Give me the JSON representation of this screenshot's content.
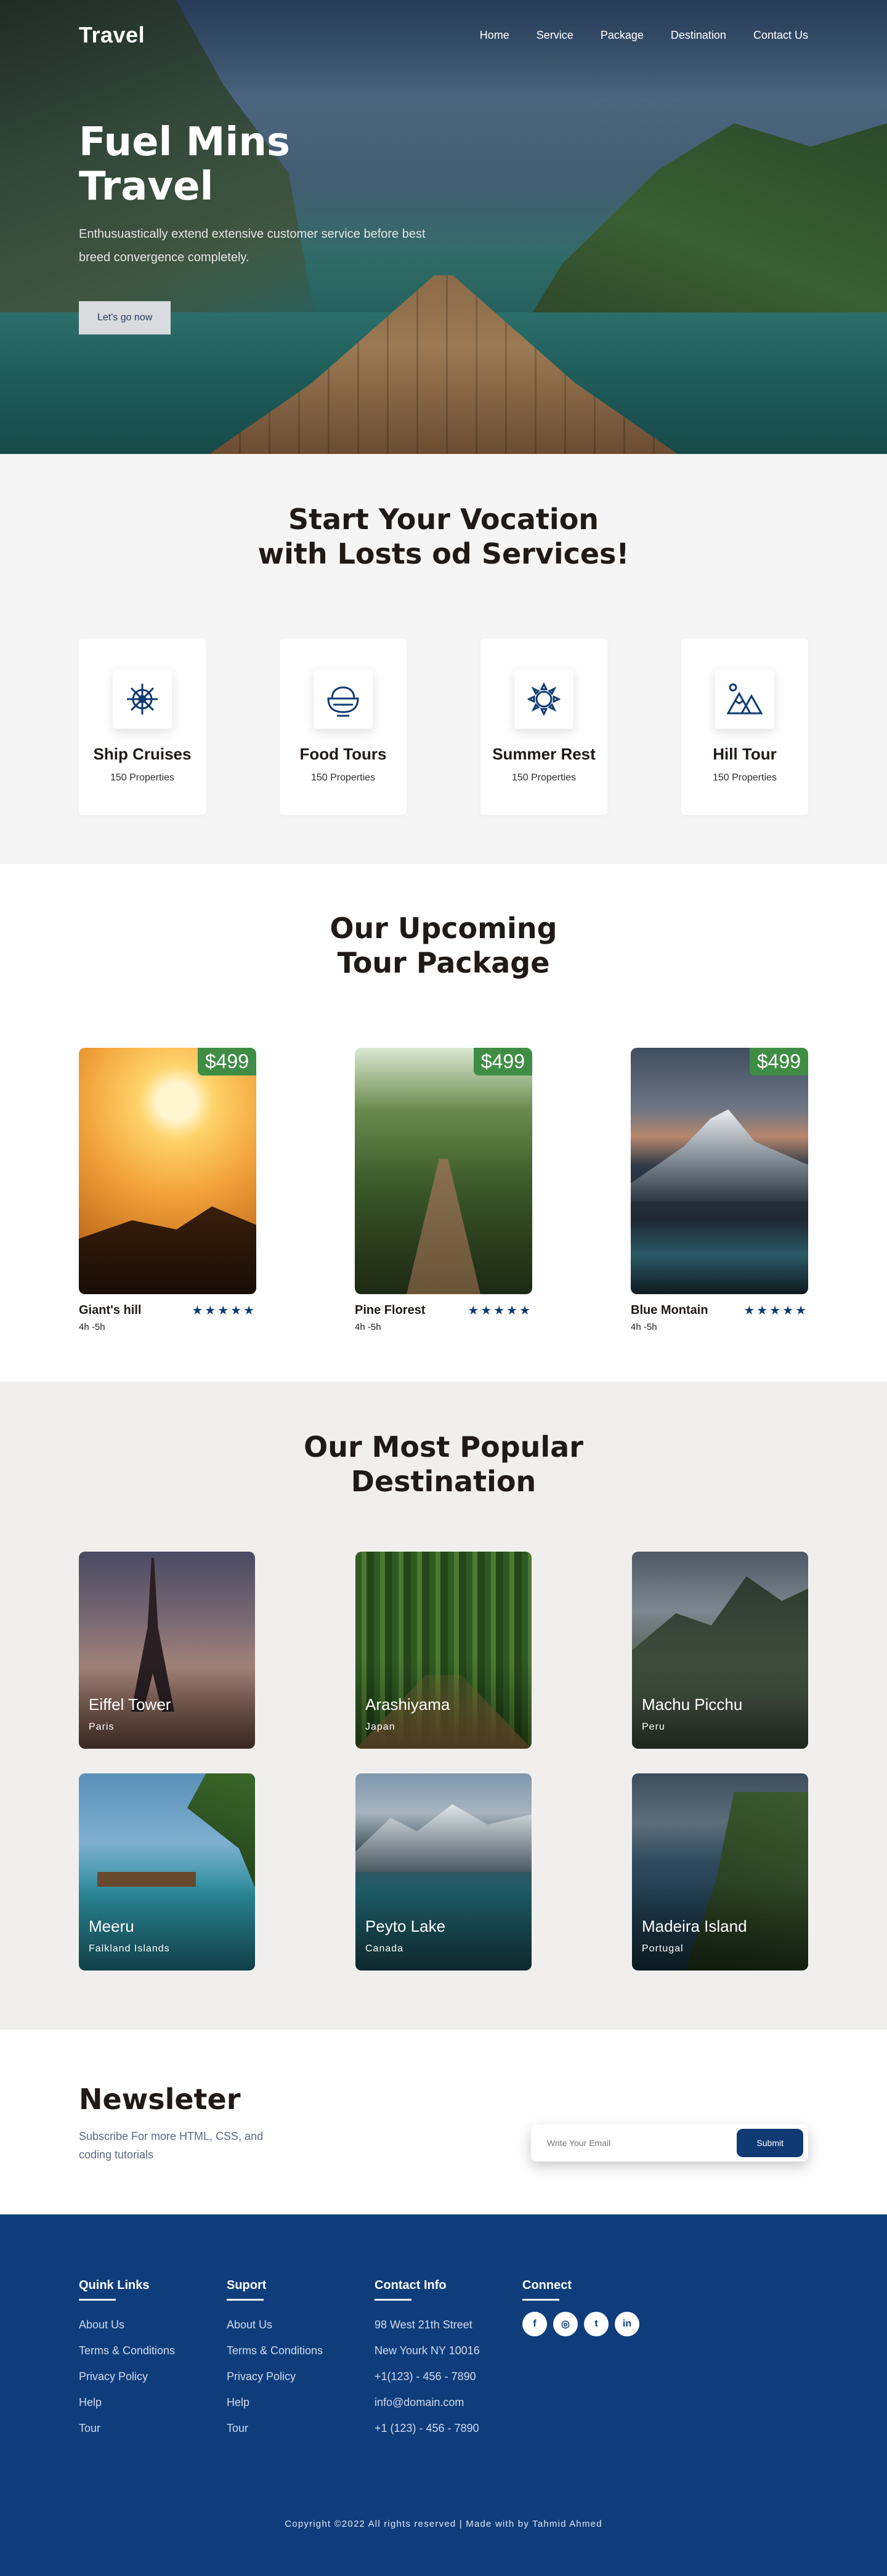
{
  "nav": {
    "logo": "Travel",
    "items": [
      "Home",
      "Service",
      "Package",
      "Destination",
      "Contact Us"
    ]
  },
  "hero": {
    "title_line1": "Fuel Mins",
    "title_line2": "Travel",
    "description": "Enthusuastically extend extensive customer service before best breed convergence completely.",
    "button": "Let's go now"
  },
  "services": {
    "title_line1": "Start Your Vocation",
    "title_line2": "with Losts od Services!",
    "cards": [
      {
        "name": "Ship Cruises",
        "sub": "150 Properties",
        "icon": "ship-wheel-icon"
      },
      {
        "name": "Food Tours",
        "sub": "150 Properties",
        "icon": "food-bowl-icon"
      },
      {
        "name": "Summer Rest",
        "sub": "150 Properties",
        "icon": "sun-icon"
      },
      {
        "name": "Hill Tour",
        "sub": "150 Properties",
        "icon": "mountain-icon"
      }
    ]
  },
  "tours": {
    "title_line1": "Our Upcoming",
    "title_line2": "Tour Package",
    "cards": [
      {
        "price": "$499",
        "name": "Giant's hill",
        "duration": "4h -5h",
        "rating": 5
      },
      {
        "price": "$499",
        "name": "Pine Florest",
        "duration": "4h -5h",
        "rating": 5
      },
      {
        "price": "$499",
        "name": "Blue Montain",
        "duration": "4h -5h",
        "rating": 5
      }
    ]
  },
  "destinations": {
    "title_line1": "Our Most Popular",
    "title_line2": "Destination",
    "cards": [
      {
        "name": "Eiffel Tower",
        "country": "Paris"
      },
      {
        "name": "Arashiyama",
        "country": "Japan"
      },
      {
        "name": "Machu Picchu",
        "country": "Peru"
      },
      {
        "name": "Meeru",
        "country": "Falkland Islands"
      },
      {
        "name": "Peyto Lake",
        "country": "Canada"
      },
      {
        "name": "Madeira Island",
        "country": "Portugal"
      }
    ]
  },
  "newsletter": {
    "title": "Newsleter",
    "subtitle": "Subscribe For more HTML, CSS, and coding tutorials",
    "placeholder": "Write Your Email",
    "button": "Submit"
  },
  "footer": {
    "col1": {
      "title": "Quink Links",
      "links": [
        "About Us",
        "Terms & Conditions",
        "Privacy Policy",
        "Help",
        "Tour"
      ]
    },
    "col2": {
      "title": "Suport",
      "links": [
        "About Us",
        "Terms & Conditions",
        "Privacy Policy",
        "Help",
        "Tour"
      ]
    },
    "col3": {
      "title": "Contact Info",
      "links": [
        "98 West 21th Street",
        "New Yourk NY 10016",
        "+1(123) - 456 - 7890",
        "info@domain.com",
        "+1 (123) - 456 - 7890"
      ]
    },
    "col4": {
      "title": "Connect",
      "socials": [
        "f",
        "◎",
        "t",
        "in"
      ]
    },
    "copyright": "Copyright ©2022 All rights reserved | Made with by Tahmid Ahmed"
  },
  "colors": {
    "primary": "#0f3d7c",
    "price": "#3f8c44",
    "services_bg": "#f5f5f5",
    "dest_bg": "#f1efed"
  }
}
